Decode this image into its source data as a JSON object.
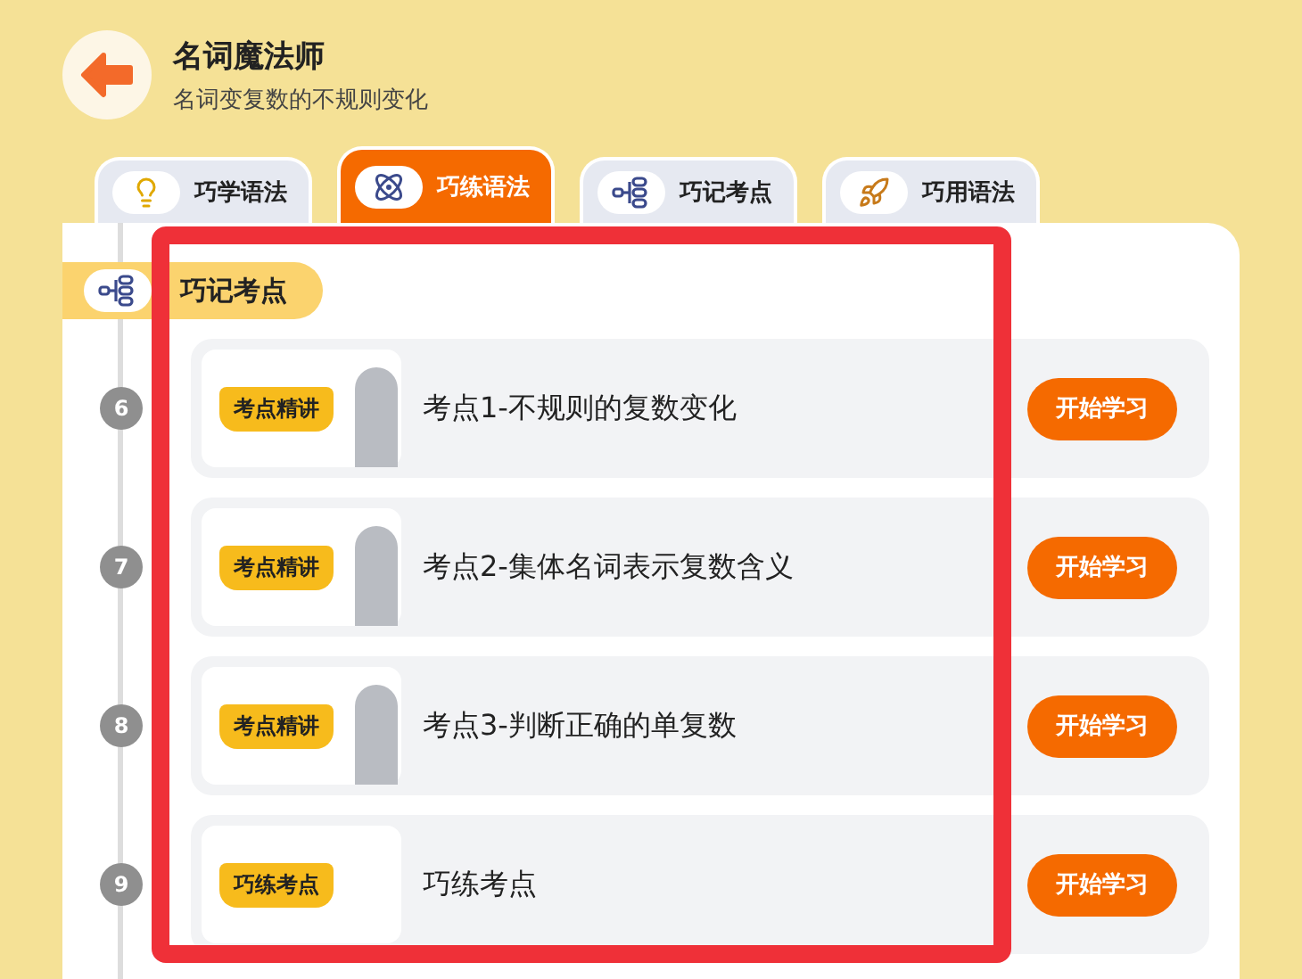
{
  "header": {
    "title": "名词魔法师",
    "subtitle": "名词变复数的不规则变化"
  },
  "tabs": [
    {
      "label": "巧学语法",
      "kind": "bulb",
      "selected": false
    },
    {
      "label": "巧练语法",
      "kind": "atom",
      "selected": true
    },
    {
      "label": "巧记考点",
      "kind": "nodes",
      "selected": false
    },
    {
      "label": "巧用语法",
      "kind": "rocket",
      "selected": false
    }
  ],
  "section": {
    "title": "巧记考点"
  },
  "lessons": [
    {
      "number": "6",
      "banner": "考点精讲",
      "has_teacher": true,
      "title": "考点1-不规则的复数变化",
      "button": "开始学习"
    },
    {
      "number": "7",
      "banner": "考点精讲",
      "has_teacher": true,
      "title": "考点2-集体名词表示复数含义",
      "button": "开始学习"
    },
    {
      "number": "8",
      "banner": "考点精讲",
      "has_teacher": true,
      "title": "考点3-判断正确的单复数",
      "button": "开始学习"
    },
    {
      "number": "9",
      "banner": "巧练考点",
      "has_teacher": false,
      "title": "巧练考点",
      "button": "开始学习"
    }
  ]
}
